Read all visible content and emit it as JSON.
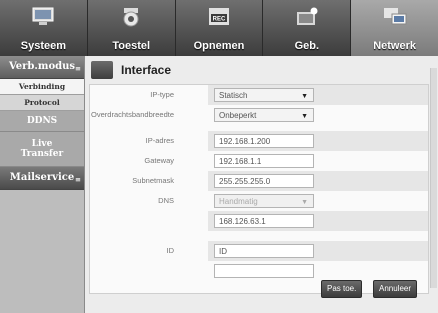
{
  "top_tabs": [
    {
      "label": "Systeem",
      "icon": "monitor-icon"
    },
    {
      "label": "Toestel",
      "icon": "camera-icon"
    },
    {
      "label": "Opnemen",
      "icon": "rec-icon"
    },
    {
      "label": "Geb.",
      "icon": "event-icon"
    },
    {
      "label": "Netwerk",
      "icon": "network-icon"
    }
  ],
  "active_tab": "Netwerk",
  "sidebar": {
    "section": "Verb.modus",
    "sub_items": [
      "Verbinding",
      "Protocol"
    ],
    "ddns": "DDNS",
    "live_line1": "Live",
    "live_line2": "Transfer",
    "mailservice": "Mailservice"
  },
  "page_title": "Interface",
  "form": {
    "ip_type": {
      "label": "IP-type",
      "value": "Statisch"
    },
    "bandwidth": {
      "label": "Overdrachtsbandbreedte",
      "value": "Onbeperkt"
    },
    "ip_address": {
      "label": "IP-adres",
      "value": "192.168.1.200"
    },
    "gateway": {
      "label": "Gateway",
      "value": "192.168.1.1"
    },
    "subnet": {
      "label": "Subnetmask",
      "value": "255.255.255.0"
    },
    "dns": {
      "label": "DNS",
      "value": "Handmatig",
      "value2": "168.126.63.1"
    },
    "id": {
      "label": "ID",
      "value": "ID"
    }
  },
  "buttons": {
    "apply": "Pas toe.",
    "cancel": "Annuleer"
  }
}
